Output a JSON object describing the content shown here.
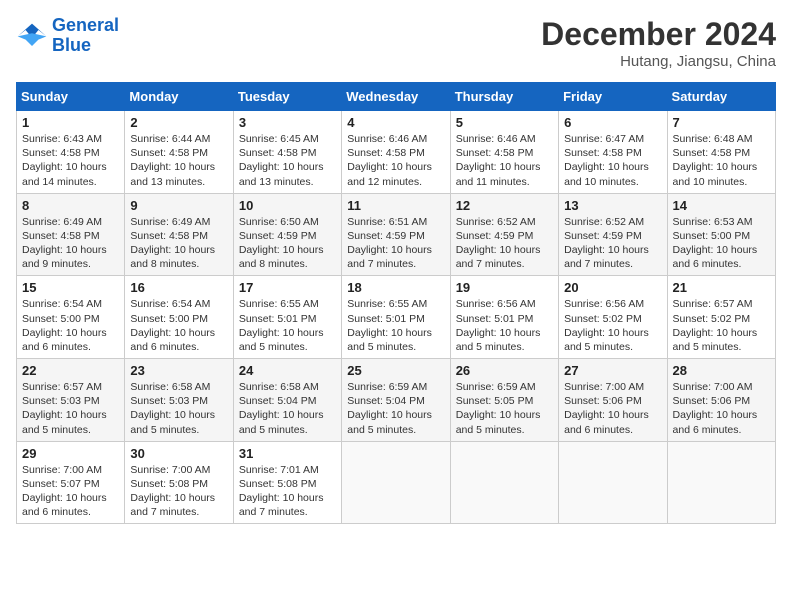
{
  "header": {
    "logo_line1": "General",
    "logo_line2": "Blue",
    "month_year": "December 2024",
    "location": "Hutang, Jiangsu, China"
  },
  "weekdays": [
    "Sunday",
    "Monday",
    "Tuesday",
    "Wednesday",
    "Thursday",
    "Friday",
    "Saturday"
  ],
  "weeks": [
    [
      {
        "day": "1",
        "info": "Sunrise: 6:43 AM\nSunset: 4:58 PM\nDaylight: 10 hours\nand 14 minutes."
      },
      {
        "day": "2",
        "info": "Sunrise: 6:44 AM\nSunset: 4:58 PM\nDaylight: 10 hours\nand 13 minutes."
      },
      {
        "day": "3",
        "info": "Sunrise: 6:45 AM\nSunset: 4:58 PM\nDaylight: 10 hours\nand 13 minutes."
      },
      {
        "day": "4",
        "info": "Sunrise: 6:46 AM\nSunset: 4:58 PM\nDaylight: 10 hours\nand 12 minutes."
      },
      {
        "day": "5",
        "info": "Sunrise: 6:46 AM\nSunset: 4:58 PM\nDaylight: 10 hours\nand 11 minutes."
      },
      {
        "day": "6",
        "info": "Sunrise: 6:47 AM\nSunset: 4:58 PM\nDaylight: 10 hours\nand 10 minutes."
      },
      {
        "day": "7",
        "info": "Sunrise: 6:48 AM\nSunset: 4:58 PM\nDaylight: 10 hours\nand 10 minutes."
      }
    ],
    [
      {
        "day": "8",
        "info": "Sunrise: 6:49 AM\nSunset: 4:58 PM\nDaylight: 10 hours\nand 9 minutes."
      },
      {
        "day": "9",
        "info": "Sunrise: 6:49 AM\nSunset: 4:58 PM\nDaylight: 10 hours\nand 8 minutes."
      },
      {
        "day": "10",
        "info": "Sunrise: 6:50 AM\nSunset: 4:59 PM\nDaylight: 10 hours\nand 8 minutes."
      },
      {
        "day": "11",
        "info": "Sunrise: 6:51 AM\nSunset: 4:59 PM\nDaylight: 10 hours\nand 7 minutes."
      },
      {
        "day": "12",
        "info": "Sunrise: 6:52 AM\nSunset: 4:59 PM\nDaylight: 10 hours\nand 7 minutes."
      },
      {
        "day": "13",
        "info": "Sunrise: 6:52 AM\nSunset: 4:59 PM\nDaylight: 10 hours\nand 7 minutes."
      },
      {
        "day": "14",
        "info": "Sunrise: 6:53 AM\nSunset: 5:00 PM\nDaylight: 10 hours\nand 6 minutes."
      }
    ],
    [
      {
        "day": "15",
        "info": "Sunrise: 6:54 AM\nSunset: 5:00 PM\nDaylight: 10 hours\nand 6 minutes."
      },
      {
        "day": "16",
        "info": "Sunrise: 6:54 AM\nSunset: 5:00 PM\nDaylight: 10 hours\nand 6 minutes."
      },
      {
        "day": "17",
        "info": "Sunrise: 6:55 AM\nSunset: 5:01 PM\nDaylight: 10 hours\nand 5 minutes."
      },
      {
        "day": "18",
        "info": "Sunrise: 6:55 AM\nSunset: 5:01 PM\nDaylight: 10 hours\nand 5 minutes."
      },
      {
        "day": "19",
        "info": "Sunrise: 6:56 AM\nSunset: 5:01 PM\nDaylight: 10 hours\nand 5 minutes."
      },
      {
        "day": "20",
        "info": "Sunrise: 6:56 AM\nSunset: 5:02 PM\nDaylight: 10 hours\nand 5 minutes."
      },
      {
        "day": "21",
        "info": "Sunrise: 6:57 AM\nSunset: 5:02 PM\nDaylight: 10 hours\nand 5 minutes."
      }
    ],
    [
      {
        "day": "22",
        "info": "Sunrise: 6:57 AM\nSunset: 5:03 PM\nDaylight: 10 hours\nand 5 minutes."
      },
      {
        "day": "23",
        "info": "Sunrise: 6:58 AM\nSunset: 5:03 PM\nDaylight: 10 hours\nand 5 minutes."
      },
      {
        "day": "24",
        "info": "Sunrise: 6:58 AM\nSunset: 5:04 PM\nDaylight: 10 hours\nand 5 minutes."
      },
      {
        "day": "25",
        "info": "Sunrise: 6:59 AM\nSunset: 5:04 PM\nDaylight: 10 hours\nand 5 minutes."
      },
      {
        "day": "26",
        "info": "Sunrise: 6:59 AM\nSunset: 5:05 PM\nDaylight: 10 hours\nand 5 minutes."
      },
      {
        "day": "27",
        "info": "Sunrise: 7:00 AM\nSunset: 5:06 PM\nDaylight: 10 hours\nand 6 minutes."
      },
      {
        "day": "28",
        "info": "Sunrise: 7:00 AM\nSunset: 5:06 PM\nDaylight: 10 hours\nand 6 minutes."
      }
    ],
    [
      {
        "day": "29",
        "info": "Sunrise: 7:00 AM\nSunset: 5:07 PM\nDaylight: 10 hours\nand 6 minutes."
      },
      {
        "day": "30",
        "info": "Sunrise: 7:00 AM\nSunset: 5:08 PM\nDaylight: 10 hours\nand 7 minutes."
      },
      {
        "day": "31",
        "info": "Sunrise: 7:01 AM\nSunset: 5:08 PM\nDaylight: 10 hours\nand 7 minutes."
      },
      {
        "day": "",
        "info": ""
      },
      {
        "day": "",
        "info": ""
      },
      {
        "day": "",
        "info": ""
      },
      {
        "day": "",
        "info": ""
      }
    ]
  ]
}
